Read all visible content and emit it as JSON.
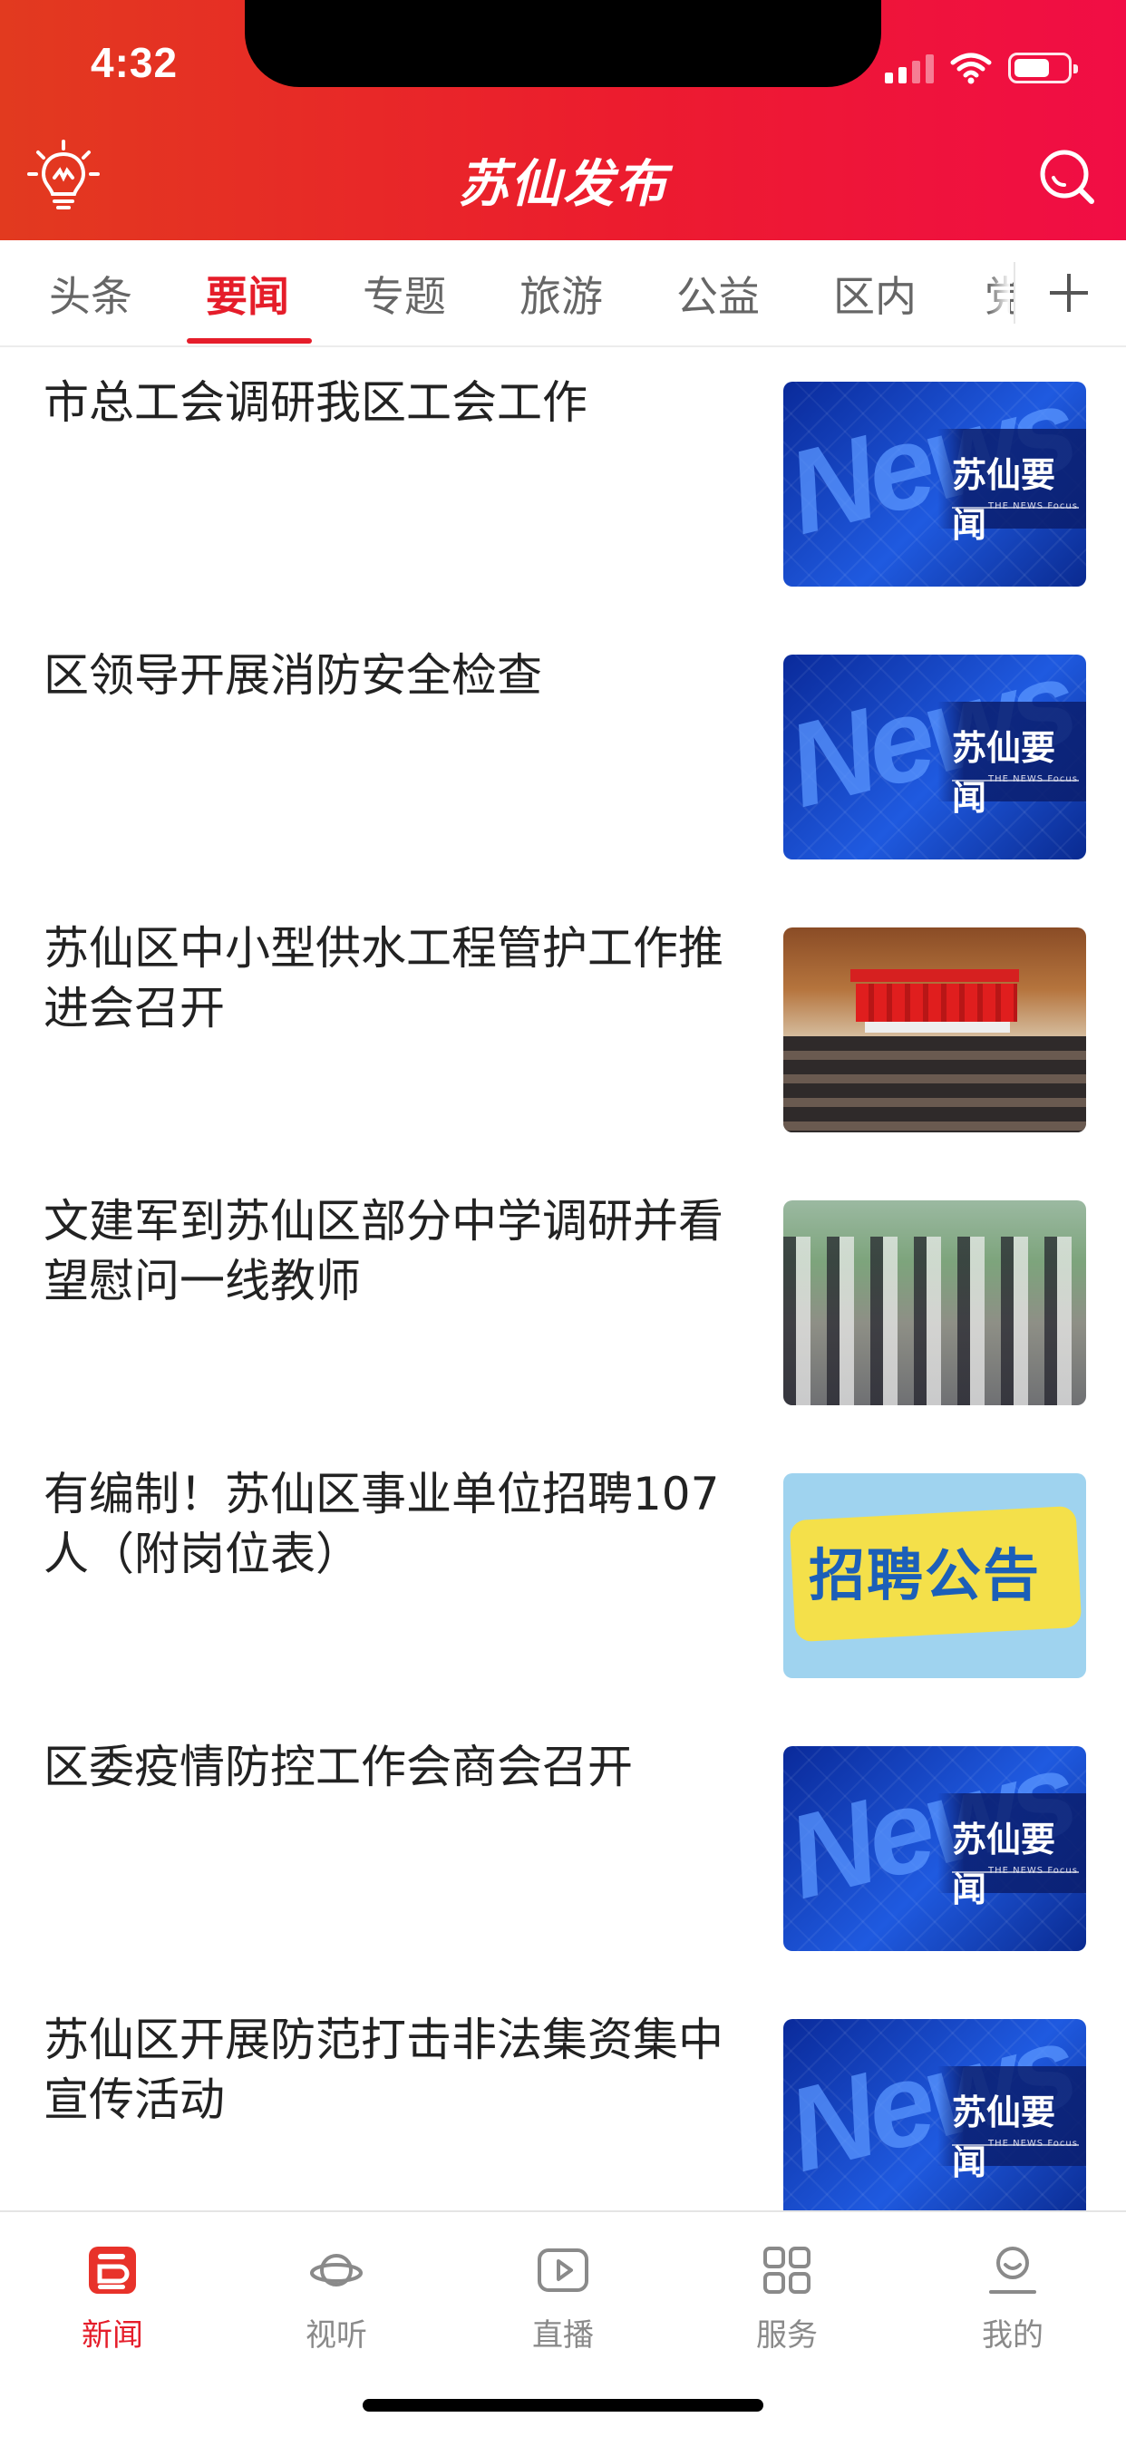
{
  "status_bar": {
    "time": "4:32"
  },
  "header": {
    "title": "苏仙发布"
  },
  "tabs": [
    {
      "label": "头条",
      "active": false
    },
    {
      "label": "要闻",
      "active": true
    },
    {
      "label": "专题",
      "active": false
    },
    {
      "label": "旅游",
      "active": false
    },
    {
      "label": "公益",
      "active": false
    },
    {
      "label": "区内",
      "active": false
    },
    {
      "label": "党",
      "active": false
    }
  ],
  "news": [
    {
      "title": "市总工会调研我区工会工作",
      "thumb": "news"
    },
    {
      "title": "区领导开展消防安全检查",
      "thumb": "news"
    },
    {
      "title": "苏仙区中小型供水工程管护工作推进会召开",
      "thumb": "meeting"
    },
    {
      "title": "文建军到苏仙区部分中学调研并看望慰问一线教师",
      "thumb": "walk"
    },
    {
      "title": "有编制！苏仙区事业单位招聘107人（附岗位表）",
      "thumb": "recruit"
    },
    {
      "title": "区委疫情防控工作会商会召开",
      "thumb": "news"
    },
    {
      "title": "苏仙区开展防范打击非法集资集中宣传活动",
      "thumb": "news"
    }
  ],
  "thumb_text": {
    "news_big": "News",
    "news_label": "苏仙要闻",
    "news_sub": "THE NEWS Focus",
    "recruit": "招聘公告"
  },
  "bottom_nav": [
    {
      "label": "新闻",
      "icon": "news-icon",
      "active": true
    },
    {
      "label": "视听",
      "icon": "planet-icon",
      "active": false
    },
    {
      "label": "直播",
      "icon": "play-icon",
      "active": false
    },
    {
      "label": "服务",
      "icon": "grid-icon",
      "active": false
    },
    {
      "label": "我的",
      "icon": "user-icon",
      "active": false
    }
  ],
  "colors": {
    "brand_red": "#e51d2a",
    "header_start": "#e23a1f",
    "header_end": "#f10d45",
    "inactive": "#8a8a8a"
  }
}
